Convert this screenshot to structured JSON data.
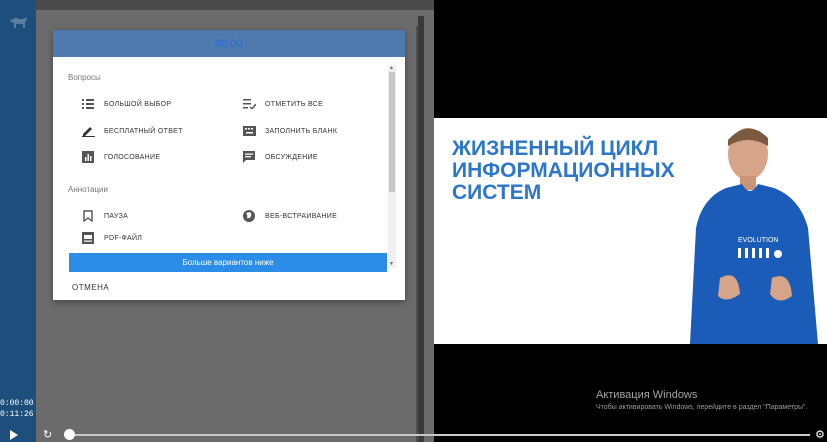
{
  "rail": {
    "time_current": "0:00:00",
    "time_total": "0:11:26"
  },
  "modal": {
    "timer": "00:00",
    "sections": [
      {
        "title": "Вопросы",
        "options": [
          {
            "label": "БОЛЬШОЙ ВЫБОР",
            "icon": "list-icon"
          },
          {
            "label": "ОТМЕТИТЬ ВСЕ",
            "icon": "checklist-icon"
          },
          {
            "label": "БЕСПЛАТНЫЙ ОТВЕТ",
            "icon": "pencil-icon"
          },
          {
            "label": "ЗАПОЛНИТЬ БЛАНК",
            "icon": "keyboard-icon"
          },
          {
            "label": "ГОЛОСОВАНИЕ",
            "icon": "poll-icon"
          },
          {
            "label": "ОБСУЖДЕНИЕ",
            "icon": "comment-icon"
          }
        ]
      },
      {
        "title": "Аннотации",
        "options": [
          {
            "label": "ПАУЗА",
            "icon": "bookmark-icon"
          },
          {
            "label": "ВЕБ-ВСТРАИВАНИЕ",
            "icon": "globe-icon"
          },
          {
            "label": "PDF-ФАЙЛ",
            "icon": "pdf-icon"
          }
        ]
      }
    ],
    "more_label": "Больше вариантов ниже",
    "cancel_label": "ОТМЕНА"
  },
  "video": {
    "slide_title": "ЖИЗНЕННЫЙ ЦИКЛ ИНФОРМАЦИОННЫХ СИСТЕМ",
    "shirt_text": "EVOLUTION"
  },
  "windows_activation": {
    "title": "Активация Windows",
    "subtitle": "Чтобы активировать Windows, перейдите в раздел \"Параметры\"."
  },
  "player": {
    "progress": 0
  },
  "colors": {
    "rail": "#1e4f7c",
    "accent": "#2b8de8",
    "slide_title": "#2e77c8"
  }
}
